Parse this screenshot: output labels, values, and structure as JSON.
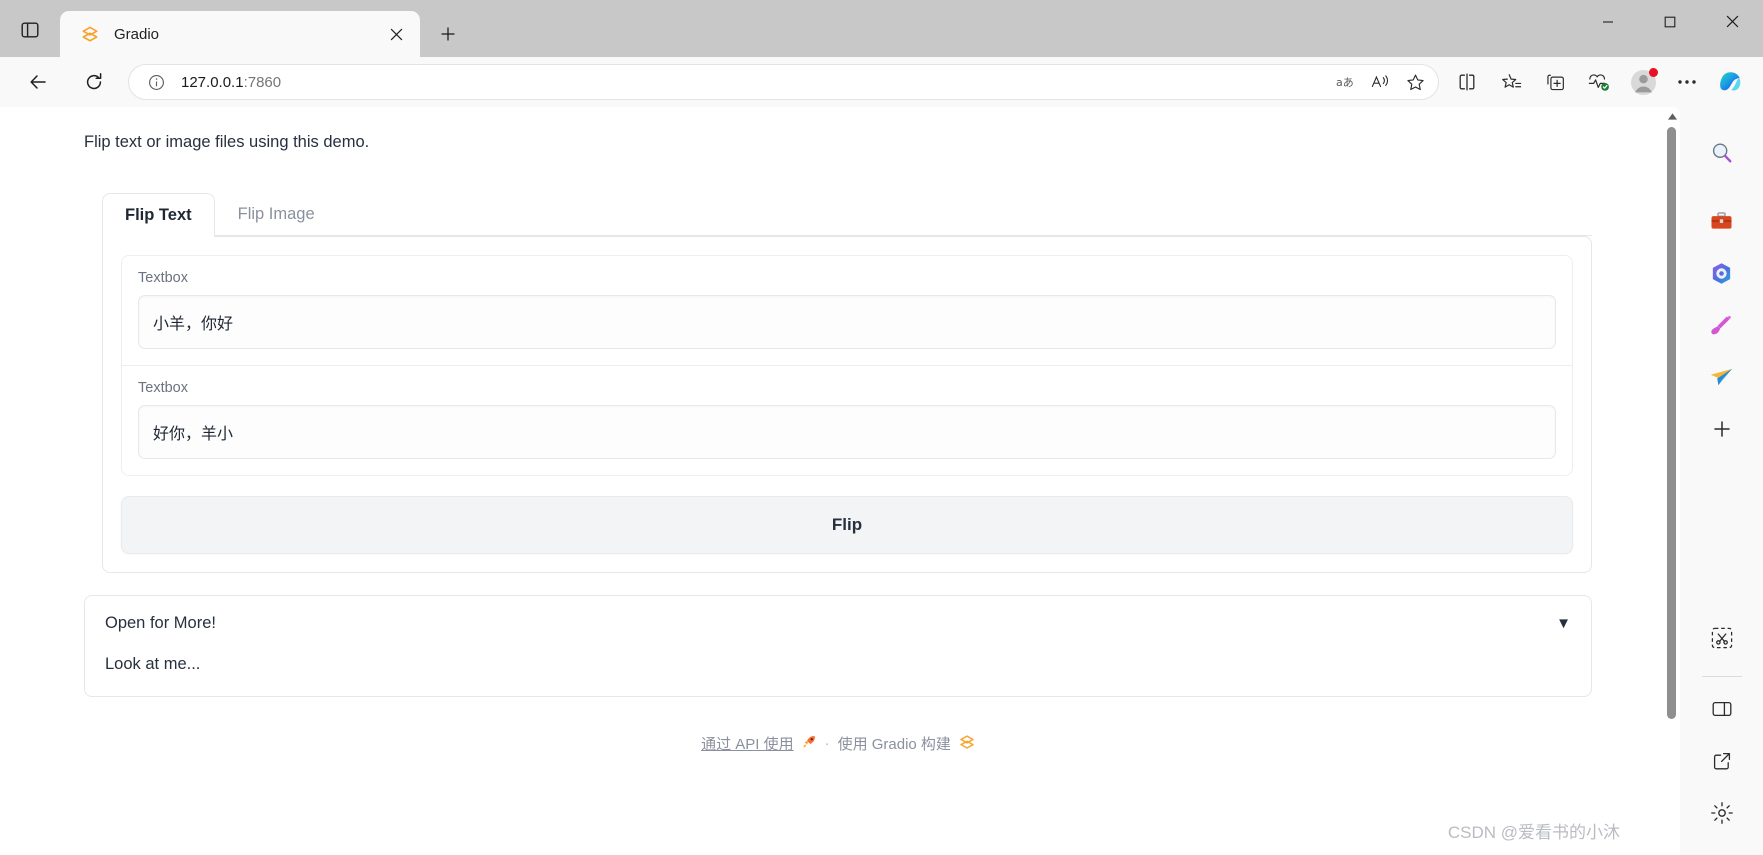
{
  "browser": {
    "tab": {
      "title": "Gradio",
      "favicon": "gradio-logo-icon"
    },
    "tab_actions": {
      "close": "×",
      "new_tab": "+",
      "tab_search": "tab-list-icon"
    },
    "window_controls": {
      "minimize": "—",
      "maximize": "□",
      "close": "✕"
    },
    "nav": {
      "back": "←",
      "reload": "⟳"
    },
    "omnibox": {
      "info_icon": "site-info-icon",
      "url_host": "127.0.0.1",
      "url_port": ":7860",
      "actions": [
        "translate-icon",
        "read-aloud-icon",
        "favorite-star-icon"
      ]
    },
    "toolbar_right": [
      "split-screen-icon",
      "favorites-icon",
      "collections-icon",
      "browser-essentials-icon",
      "profile-avatar",
      "settings-more-icon",
      "copilot-icon"
    ]
  },
  "edge_sidebar": {
    "items": [
      {
        "name": "search-icon",
        "glyph": "🔍"
      },
      {
        "name": "tools-briefcase-icon",
        "glyph": "🧰"
      },
      {
        "name": "microsoft-365-icon",
        "glyph": "◉"
      },
      {
        "name": "designer-icon",
        "glyph": "✒"
      },
      {
        "name": "outlook-send-icon",
        "glyph": "➤"
      },
      {
        "name": "add-app-icon",
        "glyph": "+"
      }
    ],
    "bottom_items": [
      {
        "name": "screenshot-snip-icon",
        "glyph": "✂"
      },
      {
        "name": "split-pane-icon",
        "glyph": "▯"
      },
      {
        "name": "open-external-icon",
        "glyph": "↗"
      },
      {
        "name": "settings-gear-icon",
        "glyph": "⚙"
      }
    ]
  },
  "gradio": {
    "description": "Flip text or image files using this demo.",
    "tabs": [
      {
        "label": "Flip Text",
        "active": true
      },
      {
        "label": "Flip Image",
        "active": false
      }
    ],
    "fields": [
      {
        "label": "Textbox",
        "value": "小羊，你好",
        "placeholder": ""
      },
      {
        "label": "Textbox",
        "value": "好你，羊小",
        "placeholder": ""
      }
    ],
    "flip_button": "Flip",
    "accordion": {
      "title": "Open for More!",
      "arrow": "▼",
      "body": "Look at me..."
    },
    "footer": {
      "api_link": "通过 API 使用",
      "api_icon": "rocket-icon",
      "separator": "·",
      "built_with": "使用 Gradio 构建",
      "gradio_icon": "gradio-logo-icon"
    }
  },
  "watermark": "CSDN @爱看书的小沐",
  "colors": {
    "accent": "#ff7c00",
    "text": "#27303f",
    "muted": "#8a919e",
    "border": "#e5e7eb",
    "chrome": "#c8c8c8",
    "toolbar": "#f9f9f9"
  }
}
